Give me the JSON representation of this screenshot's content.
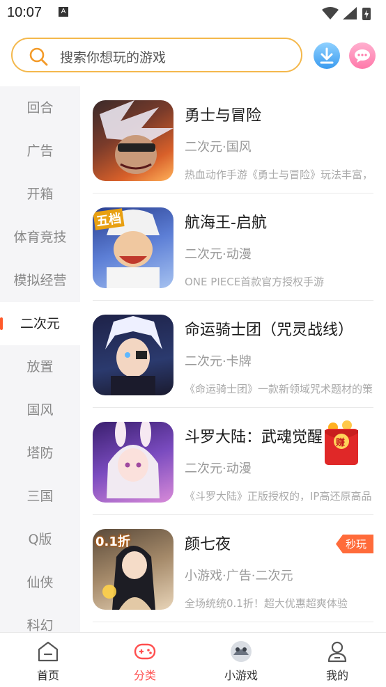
{
  "status_bar": {
    "time": "10:07",
    "notification_glyph": "A"
  },
  "search": {
    "placeholder": "搜索你想玩的游戏"
  },
  "sidebar": {
    "categories": [
      "回合",
      "广告",
      "开箱",
      "体育竞技",
      "模拟经营",
      "二次元",
      "放置",
      "国风",
      "塔防",
      "三国",
      "Q版",
      "仙侠",
      "科幻"
    ],
    "active": "二次元"
  },
  "games": [
    {
      "title": "勇士与冒险",
      "tags": "二次元·国风",
      "desc": "热血动作手游《勇士与冒险》玩法丰富，"
    },
    {
      "title": "航海王-启航",
      "tags": "二次元·动漫",
      "desc": "ONE PIECE首款官方授权手游"
    },
    {
      "title": "命运骑士团（咒灵战线）",
      "tags": "二次元·卡牌",
      "desc": "《命运骑士团》一款新领域咒术题材的策"
    },
    {
      "title": "斗罗大陆：武魂觉醒",
      "tags": "二次元·动漫",
      "desc": "《斗罗大陆》正版授权的，IP高还原高品"
    },
    {
      "title": "颜七夜",
      "tags": "小游戏·广告·二次元",
      "desc": "全场统统0.1折！超大优惠超爽体验",
      "badge": "秒玩",
      "thumb_label": "0.1折"
    }
  ],
  "thumb_label_game2": "五档",
  "envelope_label": "赚",
  "bottom_nav": [
    {
      "label": "首页"
    },
    {
      "label": "分类"
    },
    {
      "label": "小游戏"
    },
    {
      "label": "我的"
    }
  ],
  "colors": {
    "accent": "#ff4e4e",
    "search_border": "#f4b84c",
    "badge": "#ff6b3a"
  }
}
